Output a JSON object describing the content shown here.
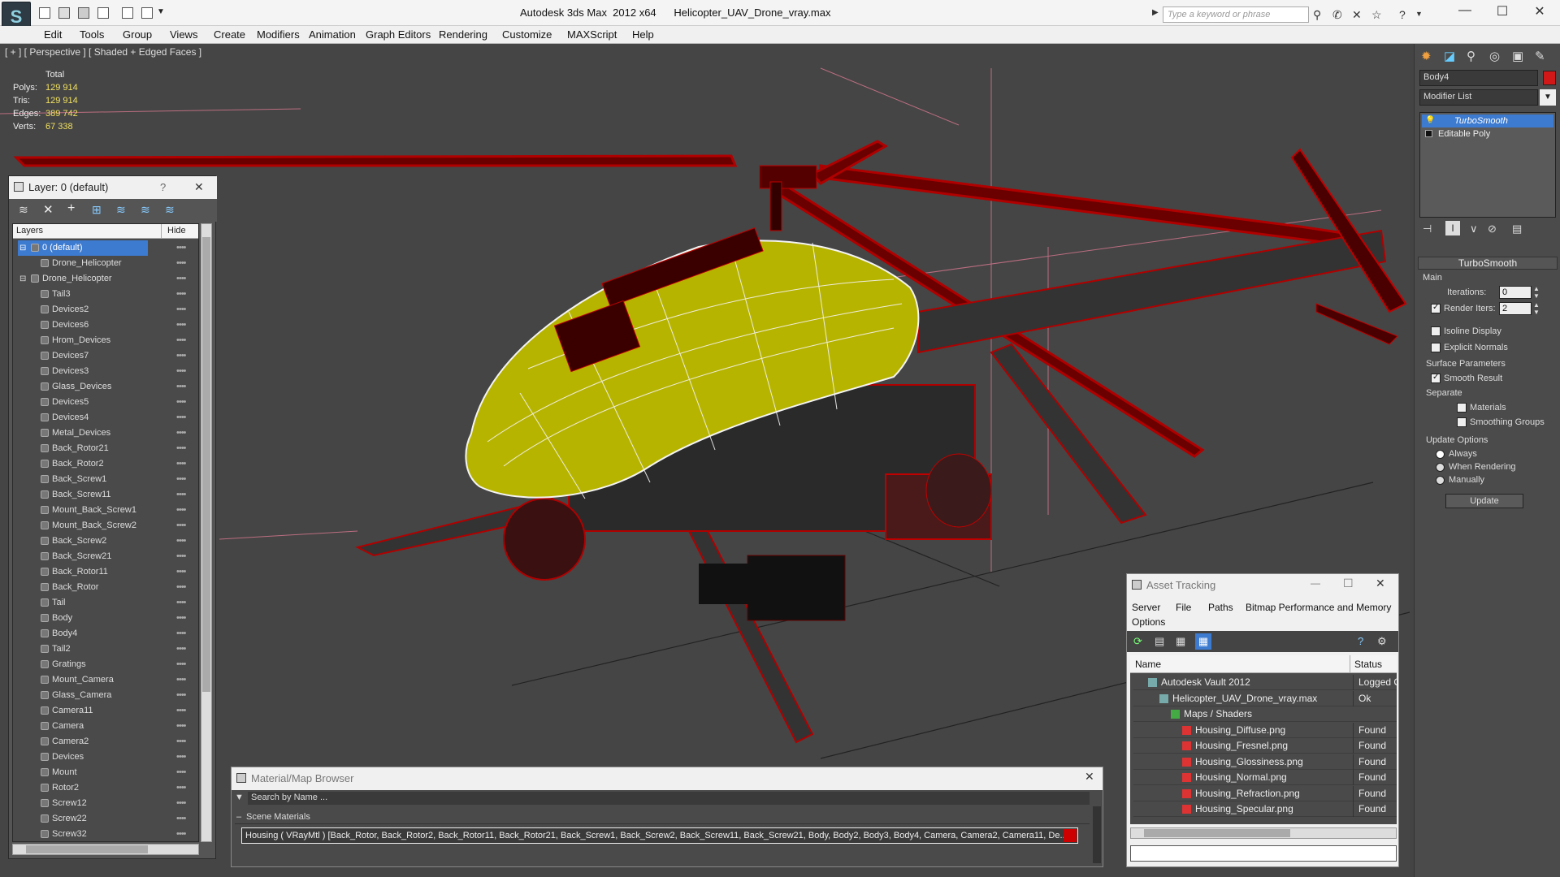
{
  "app": {
    "title": "Autodesk 3ds Max  2012 x64      Helicopter_UAV_Drone_vray.max",
    "search_placeholder": "Type a keyword or phrase"
  },
  "menu": [
    "Edit",
    "Tools",
    "Group",
    "Views",
    "Create",
    "Modifiers",
    "Animation",
    "Graph Editors",
    "Rendering",
    "Customize",
    "MAXScript",
    "Help"
  ],
  "viewport": {
    "label": "[ + ] [ Perspective ] [ Shaded + Edged Faces ]",
    "stats": {
      "total_label": "Total",
      "polys_label": "Polys:",
      "polys": "129 914",
      "tris_label": "Tris:",
      "tris": "129 914",
      "edges_label": "Edges:",
      "edges": "389 742",
      "verts_label": "Verts:",
      "verts": "67 338"
    }
  },
  "command_panel": {
    "object_name": "Body4",
    "object_color": "#d01818",
    "modifier_list_label": "Modifier List",
    "stack": [
      "TurboSmooth",
      "Editable Poly"
    ],
    "rollout_title": "TurboSmooth",
    "main_label": "Main",
    "iterations_label": "Iterations:",
    "iterations": "0",
    "render_iters_label": "Render Iters:",
    "render_iters": "2",
    "isoline_label": "Isoline Display",
    "explicit_normals_label": "Explicit Normals",
    "surface_params_label": "Surface Parameters",
    "smooth_result_label": "Smooth Result",
    "separate_label": "Separate",
    "materials_label": "Materials",
    "smoothing_groups_label": "Smoothing Groups",
    "update_options_label": "Update Options",
    "always_label": "Always",
    "when_rendering_label": "When Rendering",
    "manually_label": "Manually",
    "update_button": "Update"
  },
  "layer_panel": {
    "title": "Layer: 0 (default)",
    "help": "?",
    "col_layers": "Layers",
    "col_hide": "Hide",
    "rows": [
      {
        "name": "0 (default)",
        "level": 0,
        "selected": true
      },
      {
        "name": "Drone_Helicopter",
        "level": 1
      },
      {
        "name": "Drone_Helicopter",
        "level": 0
      },
      {
        "name": "Tail3",
        "level": 1
      },
      {
        "name": "Devices2",
        "level": 1
      },
      {
        "name": "Devices6",
        "level": 1
      },
      {
        "name": "Hrom_Devices",
        "level": 1
      },
      {
        "name": "Devices7",
        "level": 1
      },
      {
        "name": "Devices3",
        "level": 1
      },
      {
        "name": "Glass_Devices",
        "level": 1
      },
      {
        "name": "Devices5",
        "level": 1
      },
      {
        "name": "Devices4",
        "level": 1
      },
      {
        "name": "Metal_Devices",
        "level": 1
      },
      {
        "name": "Back_Rotor21",
        "level": 1
      },
      {
        "name": "Back_Rotor2",
        "level": 1
      },
      {
        "name": "Back_Screw1",
        "level": 1
      },
      {
        "name": "Back_Screw11",
        "level": 1
      },
      {
        "name": "Mount_Back_Screw1",
        "level": 1
      },
      {
        "name": "Mount_Back_Screw2",
        "level": 1
      },
      {
        "name": "Back_Screw2",
        "level": 1
      },
      {
        "name": "Back_Screw21",
        "level": 1
      },
      {
        "name": "Back_Rotor11",
        "level": 1
      },
      {
        "name": "Back_Rotor",
        "level": 1
      },
      {
        "name": "Tail",
        "level": 1
      },
      {
        "name": "Body",
        "level": 1
      },
      {
        "name": "Body4",
        "level": 1
      },
      {
        "name": "Tail2",
        "level": 1
      },
      {
        "name": "Gratings",
        "level": 1
      },
      {
        "name": "Mount_Camera",
        "level": 1
      },
      {
        "name": "Glass_Camera",
        "level": 1
      },
      {
        "name": "Camera11",
        "level": 1
      },
      {
        "name": "Camera",
        "level": 1
      },
      {
        "name": "Camera2",
        "level": 1
      },
      {
        "name": "Devices",
        "level": 1
      },
      {
        "name": "Mount",
        "level": 1
      },
      {
        "name": "Rotor2",
        "level": 1
      },
      {
        "name": "Screw12",
        "level": 1
      },
      {
        "name": "Screw22",
        "level": 1
      },
      {
        "name": "Screw32",
        "level": 1
      }
    ]
  },
  "asset_tracking": {
    "title": "Asset Tracking",
    "menu": [
      "Server",
      "File",
      "Paths",
      "Bitmap Performance and Memory"
    ],
    "menu2": "Options",
    "col_name": "Name",
    "col_status": "Status",
    "rows": [
      {
        "name": "Autodesk Vault 2012",
        "status": "Logged O",
        "indent": 1
      },
      {
        "name": "Helicopter_UAV_Drone_vray.max",
        "status": "Ok",
        "indent": 2
      },
      {
        "name": "Maps / Shaders",
        "status": "",
        "indent": 3
      },
      {
        "name": "Housing_Diffuse.png",
        "status": "Found",
        "indent": 4
      },
      {
        "name": "Housing_Fresnel.png",
        "status": "Found",
        "indent": 4
      },
      {
        "name": "Housing_Glossiness.png",
        "status": "Found",
        "indent": 4
      },
      {
        "name": "Housing_Normal.png",
        "status": "Found",
        "indent": 4
      },
      {
        "name": "Housing_Refraction.png",
        "status": "Found",
        "indent": 4
      },
      {
        "name": "Housing_Specular.png",
        "status": "Found",
        "indent": 4
      }
    ]
  },
  "material_browser": {
    "title": "Material/Map Browser",
    "search_placeholder": "Search by Name ...",
    "section": "Scene Materials",
    "material_entry": "Housing  ( VRayMtl )  [Back_Rotor, Back_Rotor2, Back_Rotor11, Back_Rotor21, Back_Screw1, Back_Screw2, Back_Screw11, Back_Screw21, Body, Body2, Body3, Body4, Camera, Camera2, Camera11, De..."
  }
}
